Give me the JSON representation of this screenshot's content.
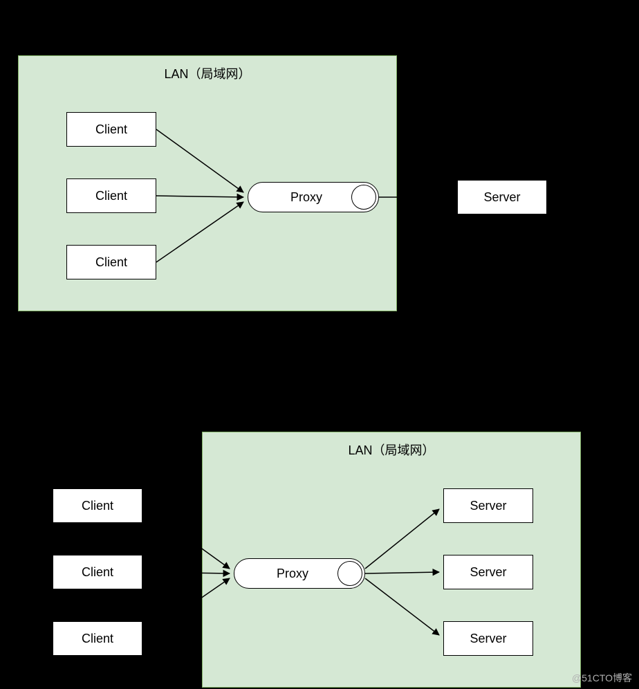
{
  "diagram1": {
    "lan_label": "LAN（局域网）",
    "clients": [
      "Client",
      "Client",
      "Client"
    ],
    "proxy": "Proxy",
    "server": "Server"
  },
  "diagram2": {
    "lan_label": "LAN（局域网）",
    "clients": [
      "Client",
      "Client",
      "Client"
    ],
    "proxy": "Proxy",
    "servers": [
      "Server",
      "Server",
      "Server"
    ]
  },
  "watermark": "@51CTO博客"
}
